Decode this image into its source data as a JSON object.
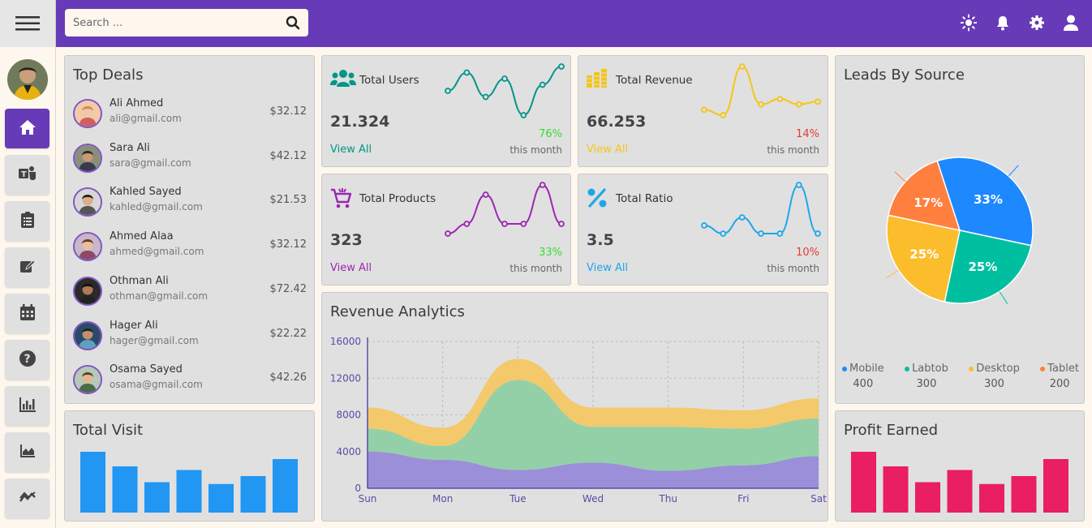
{
  "search": {
    "placeholder": "Search ..."
  },
  "top_deals": {
    "title": "Top Deals",
    "deals": [
      {
        "name": "Ali Ahmed",
        "email": "ali@gmail.com",
        "amount": "$32.12"
      },
      {
        "name": "Sara Ali",
        "email": "sara@gmail.com",
        "amount": "$42.12"
      },
      {
        "name": "Kahled Sayed",
        "email": "kahled@gmail.com",
        "amount": "$21.53"
      },
      {
        "name": "Ahmed Alaa",
        "email": "ahmed@gmail.com",
        "amount": "$32.12"
      },
      {
        "name": "Othman Ali",
        "email": "othman@gmail.com",
        "amount": "$72.42"
      },
      {
        "name": "Hager Ali",
        "email": "hager@gmail.com",
        "amount": "$22.22"
      },
      {
        "name": "Osama Sayed",
        "email": "osama@gmail.com",
        "amount": "$42.26"
      }
    ]
  },
  "stats": [
    {
      "label": "Total Users",
      "value": "21.324",
      "link": "View All",
      "pct": "76%",
      "sub": "this month",
      "color": "#009688",
      "pct_color": "#33dd33",
      "spark": [
        5,
        8,
        4,
        7,
        1,
        6,
        9
      ]
    },
    {
      "label": "Total Revenue",
      "value": "66.253",
      "link": "View All",
      "pct": "14%",
      "sub": "this month",
      "color": "#f5c518",
      "pct_color": "#e53935",
      "spark": [
        2,
        1,
        10,
        3,
        4,
        3,
        3.5
      ]
    },
    {
      "label": "Total Products",
      "value": "323",
      "link": "View All",
      "pct": "33%",
      "sub": "this month",
      "color": "#9c27b0",
      "pct_color": "#33dd33",
      "spark": [
        1,
        2,
        5,
        2,
        2,
        6,
        2
      ]
    },
    {
      "label": "Total Ratio",
      "value": "3.5",
      "link": "View All",
      "pct": "10%",
      "sub": "this month",
      "color": "#1ea7e8",
      "pct_color": "#e53935",
      "spark": [
        3,
        2,
        4,
        2,
        2,
        8,
        2
      ]
    }
  ],
  "revenue_analytics": {
    "title": "Revenue Analytics"
  },
  "leads": {
    "title": "Leads By Source",
    "legend": [
      {
        "label": "Mobile",
        "value": "400",
        "color": "#1e88ff"
      },
      {
        "label": "Labtob",
        "value": "300",
        "color": "#00bfa0"
      },
      {
        "label": "Desktop",
        "value": "300",
        "color": "#fbbd2b"
      },
      {
        "label": "Tablet",
        "value": "200",
        "color": "#ff7f3f"
      }
    ]
  },
  "total_visit": {
    "title": "Total Visit",
    "color": "#2196f3"
  },
  "profit_earned": {
    "title": "Profit Earned",
    "color": "#e91e63"
  },
  "chart_data": [
    {
      "type": "area",
      "title": "Revenue Analytics",
      "x": [
        "Sun",
        "Mon",
        "Tue",
        "Wed",
        "Thu",
        "Fri",
        "Sat"
      ],
      "ylim": [
        0,
        16000
      ],
      "yticks": [
        0,
        4000,
        8000,
        12000,
        16000
      ],
      "grid": true,
      "stacked": true,
      "series": [
        {
          "values": [
            4000,
            3100,
            2000,
            2800,
            1900,
            2500,
            3500
          ],
          "color": "#9b8fd9"
        },
        {
          "values": [
            2500,
            1500,
            9800,
            3900,
            4800,
            4000,
            4100
          ],
          "color": "#93d0a8"
        },
        {
          "values": [
            2300,
            2000,
            2300,
            2100,
            2100,
            2000,
            2200
          ],
          "color": "#f3c96b"
        }
      ]
    },
    {
      "type": "pie",
      "title": "Leads By Source",
      "categories": [
        "Mobile",
        "Labtob",
        "Desktop",
        "Tablet"
      ],
      "values": [
        400,
        300,
        300,
        200
      ],
      "labels": [
        "33%",
        "25%",
        "25%",
        "17%"
      ],
      "legend": "bottom"
    },
    {
      "type": "bar",
      "title": "Total Visit",
      "values": [
        100,
        76,
        50,
        70,
        47,
        60,
        88
      ]
    },
    {
      "type": "bar",
      "title": "Profit Earned",
      "values": [
        100,
        76,
        50,
        70,
        47,
        60,
        88
      ]
    }
  ]
}
